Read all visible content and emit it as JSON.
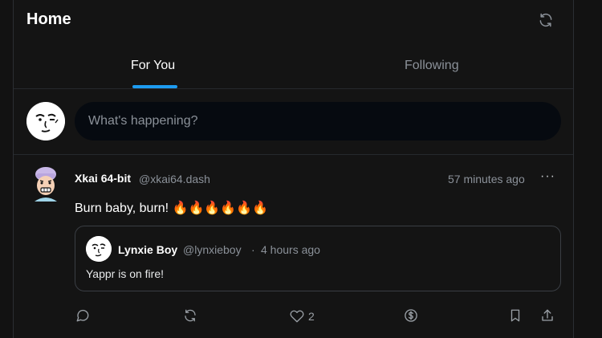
{
  "header": {
    "title": "Home",
    "refresh_icon": "refresh-icon"
  },
  "tabs": [
    {
      "label": "For You",
      "active": true
    },
    {
      "label": "Following",
      "active": false
    }
  ],
  "composer": {
    "placeholder": "What's happening?"
  },
  "post": {
    "author_name": "Xkai 64-bit",
    "author_handle": "@xkai64.dash",
    "time": "57 minutes ago",
    "more_label": "···",
    "text": "Burn baby, burn! 🔥🔥🔥🔥🔥🔥",
    "quote": {
      "author_name": "Lynxie Boy",
      "author_handle": "@lynxieboy",
      "separator": "·",
      "time": "4 hours ago",
      "text": "Yappr is on fire!"
    },
    "actions": {
      "reply_icon": "reply-icon",
      "repost_icon": "repost-icon",
      "like_icon": "heart-icon",
      "like_count": "2",
      "tip_icon": "dollar-icon",
      "bookmark_icon": "bookmark-icon",
      "share_icon": "share-icon"
    }
  },
  "colors": {
    "background": "#121212",
    "accent": "#1d9bf0",
    "muted_text": "#8b9199",
    "input_bg": "#060a10"
  }
}
